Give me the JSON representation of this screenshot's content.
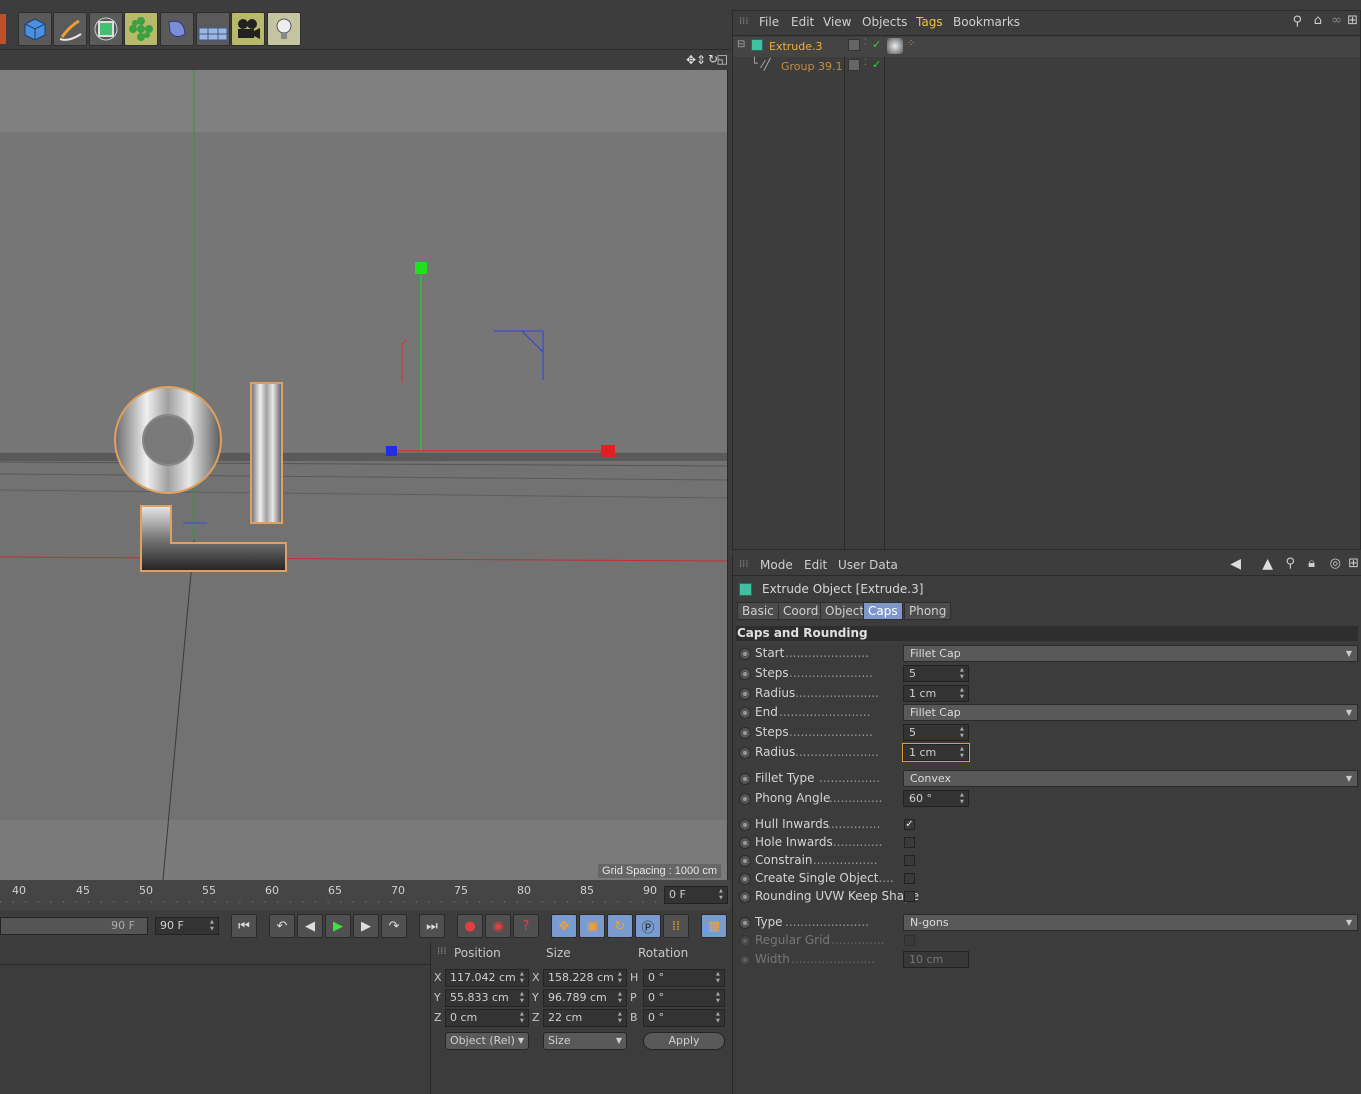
{
  "toolbar": {
    "icons": [
      "cube-icon",
      "pen-icon",
      "subdivision-icon",
      "cloner-icon",
      "deformer-icon",
      "floor-icon",
      "camera-icon",
      "light-icon"
    ]
  },
  "viewport": {
    "grid_spacing": "Grid Spacing : 1000 cm"
  },
  "timeline": {
    "ticks": [
      "40",
      "45",
      "50",
      "55",
      "60",
      "65",
      "70",
      "75",
      "80",
      "85",
      "90"
    ],
    "current_frame": "0 F",
    "end_frame_slider": "90 F",
    "end_frame_field": "90 F"
  },
  "coord": {
    "headers": {
      "position": "Position",
      "size": "Size",
      "rotation": "Rotation"
    },
    "rows": [
      {
        "axis": "X",
        "pos": "117.042 cm",
        "saxis": "X",
        "size": "158.228 cm",
        "raxis": "H",
        "rot": "0 °"
      },
      {
        "axis": "Y",
        "pos": "55.833 cm",
        "saxis": "Y",
        "size": "96.789 cm",
        "raxis": "P",
        "rot": "0 °"
      },
      {
        "axis": "Z",
        "pos": "0 cm",
        "saxis": "Z",
        "size": "22 cm",
        "raxis": "B",
        "rot": "0 °"
      }
    ],
    "mode_select": "Object (Rel)",
    "size_select": "Size",
    "apply": "Apply"
  },
  "object_manager": {
    "menu": [
      "File",
      "Edit",
      "View",
      "Objects",
      "Tags",
      "Bookmarks"
    ],
    "objects": [
      {
        "name": "Extrude.3"
      },
      {
        "name": "Group 39.1"
      }
    ]
  },
  "attribute_manager": {
    "menu": [
      "Mode",
      "Edit",
      "User Data"
    ],
    "title": "Extrude Object [Extrude.3]",
    "tabs": [
      "Basic",
      "Coord.",
      "Object",
      "Caps",
      "Phong"
    ],
    "section": "Caps and Rounding",
    "params": {
      "start_label": "Start",
      "start_value": "Fillet Cap",
      "steps1_label": "Steps",
      "steps1_value": "5",
      "radius1_label": "Radius",
      "radius1_value": "1 cm",
      "end_label": "End",
      "end_value": "Fillet Cap",
      "steps2_label": "Steps",
      "steps2_value": "5",
      "radius2_label": "Radius",
      "radius2_value": "1 cm",
      "fillet_type_label": "Fillet Type",
      "fillet_type_value": "Convex",
      "phong_label": "Phong Angle",
      "phong_value": "60 °",
      "hull_label": "Hull Inwards",
      "hole_label": "Hole Inwards",
      "constrain_label": "Constrain",
      "single_label": "Create Single Object",
      "uvw_label": "Rounding UVW Keep Shape",
      "type_label": "Type",
      "type_value": "N-gons",
      "regular_label": "Regular Grid",
      "width_label": "Width",
      "width_value": "10 cm"
    }
  },
  "colors": {
    "accent_tab": "#7d98c8",
    "object_name": "#e8a020",
    "axis_x": "#e03030",
    "axis_y": "#30d030",
    "axis_z": "#3050e0"
  }
}
